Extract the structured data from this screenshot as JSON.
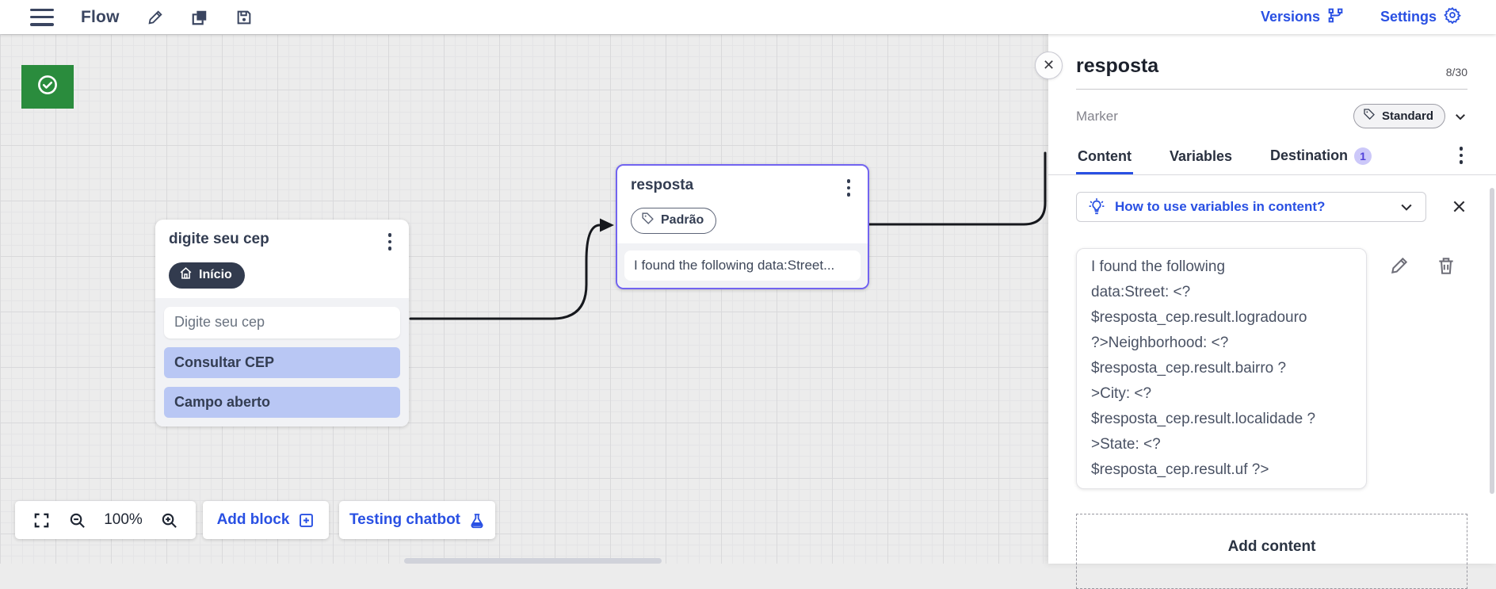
{
  "header": {
    "title": "Flow",
    "versions_label": "Versions",
    "settings_label": "Settings"
  },
  "canvas": {
    "zoom_level": "100%",
    "add_block_label": "Add block",
    "testing_label": "Testing chatbot",
    "start_block": {
      "title": "digite seu cep",
      "badge": "Início",
      "input_placeholder": "Digite seu cep",
      "buttons": [
        "Consultar CEP",
        "Campo aberto"
      ]
    },
    "resposta_block": {
      "title": "resposta",
      "badge": "Padrão",
      "preview": "I found the following data:Street..."
    }
  },
  "panel": {
    "title": "resposta",
    "char_count": "8/30",
    "marker_label": "Marker",
    "marker_value": "Standard",
    "tabs": [
      {
        "label": "Content"
      },
      {
        "label": "Variables"
      },
      {
        "label": "Destination",
        "badge": "1"
      }
    ],
    "banner_text": "How to use variables in content?",
    "content_lines": [
      "I found the following",
      "data:Street: <?",
      "$resposta_cep.result.logradouro",
      "?>Neighborhood: <?",
      "$resposta_cep.result.bairro ?",
      ">City: <?",
      "$resposta_cep.result.localidade ?",
      ">State: <?",
      "$resposta_cep.result.uf ?>"
    ],
    "add_content_label": "Add content"
  },
  "colors": {
    "accent_blue": "#2950e3",
    "selected_purple": "#7264f0",
    "badge_purple_bg": "#ccc8f9",
    "start_green": "#2a8c3d",
    "option_button_blue": "#b9c7f4",
    "dark_navy": "#333d52"
  }
}
